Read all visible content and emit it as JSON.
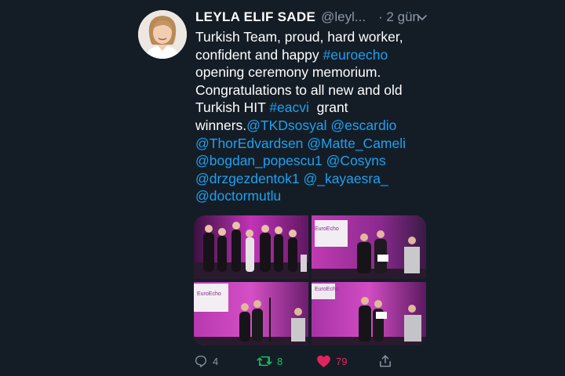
{
  "tweet": {
    "author_name": "LEYLA ELIF SADE",
    "handle": "@leyl...",
    "time": "· 2 gün",
    "lines": [
      [
        {
          "t": "Turkish Team, proud, hard worker,",
          "link": false
        }
      ],
      [
        {
          "t": "confident and happy ",
          "link": false
        },
        {
          "t": "#euroecho",
          "link": true
        }
      ],
      [
        {
          "t": "opening ceremony memorium.",
          "link": false
        }
      ],
      [
        {
          "t": "Congratulations to all new and old",
          "link": false
        }
      ],
      [
        {
          "t": "Turkish HIT ",
          "link": false
        },
        {
          "t": "#eacvi",
          "link": true
        },
        {
          "t": "  grant",
          "link": false
        }
      ],
      [
        {
          "t": "winners.",
          "link": false
        },
        {
          "t": "@TKDsosyal",
          "link": true
        },
        {
          "t": " ",
          "link": false
        },
        {
          "t": "@escardio",
          "link": true
        }
      ],
      [
        {
          "t": "@ThorEdvardsen",
          "link": true
        },
        {
          "t": " ",
          "link": false
        },
        {
          "t": "@Matte_Cameli",
          "link": true
        }
      ],
      [
        {
          "t": "@bogdan_popescu1",
          "link": true
        },
        {
          "t": " ",
          "link": false
        },
        {
          "t": "@Cosyns",
          "link": true
        }
      ],
      [
        {
          "t": "@drzgezdentok1",
          "link": true
        },
        {
          "t": " ",
          "link": false
        },
        {
          "t": "@_kayaesra_",
          "link": true
        }
      ],
      [
        {
          "t": "@doctormutlu",
          "link": true
        }
      ]
    ]
  },
  "actions": {
    "reply_count": "4",
    "retweet_count": "8",
    "like_count": "79"
  },
  "media": {
    "photo_texts": [
      "EuroEcho",
      "EuroEcho",
      "EuroEcho"
    ]
  },
  "colors": {
    "background": "#141d26",
    "link": "#1da1f2",
    "muted": "#8899a6",
    "retweet": "#17bf63",
    "like": "#e0245e"
  }
}
